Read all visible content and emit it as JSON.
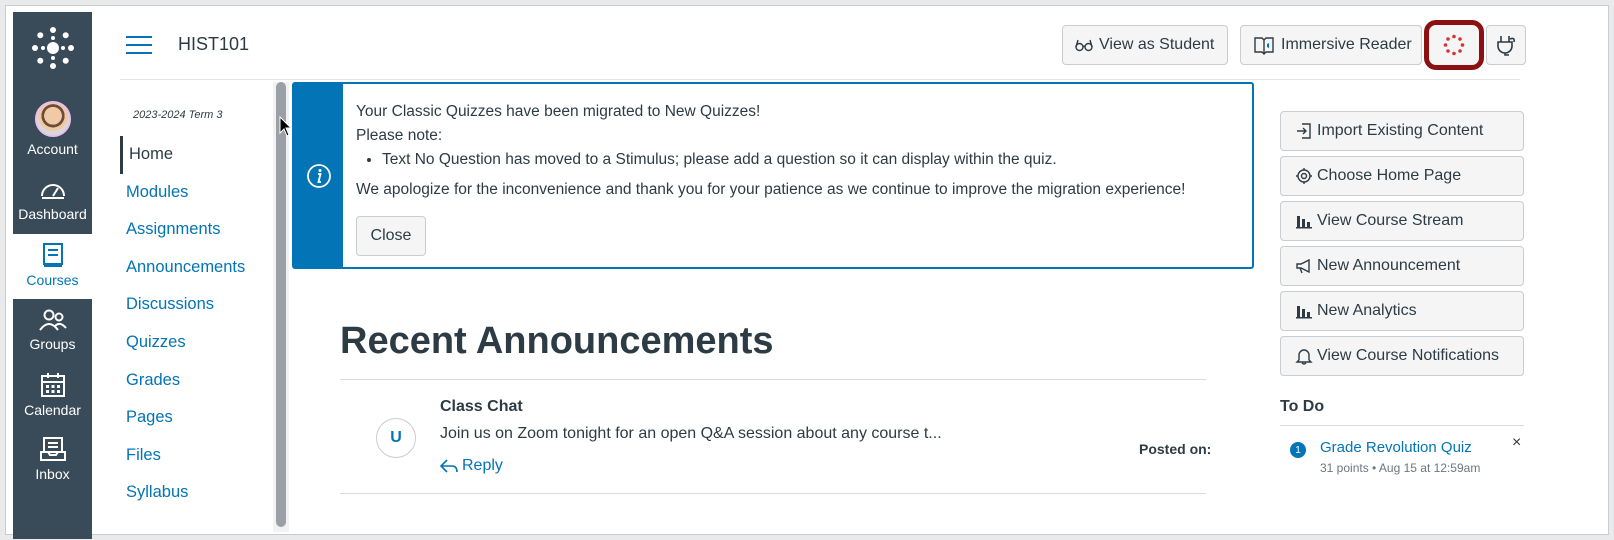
{
  "global_nav": {
    "items": [
      {
        "label": "Account",
        "icon": "account-avatar"
      },
      {
        "label": "Dashboard",
        "icon": "dashboard-icon"
      },
      {
        "label": "Courses",
        "icon": "courses-icon"
      },
      {
        "label": "Groups",
        "icon": "groups-icon"
      },
      {
        "label": "Calendar",
        "icon": "calendar-icon"
      },
      {
        "label": "Inbox",
        "icon": "inbox-icon"
      }
    ],
    "active": "Courses"
  },
  "header": {
    "course_code": "HIST101",
    "view_as_student": "View as Student",
    "immersive_reader": "Immersive Reader"
  },
  "course_nav": {
    "term": "2023-2024 Term 3",
    "items": [
      "Home",
      "Modules",
      "Assignments",
      "Announcements",
      "Discussions",
      "Quizzes",
      "Grades",
      "Pages",
      "Files",
      "Syllabus"
    ],
    "active": "Home"
  },
  "alert": {
    "line1": "Your Classic Quizzes have been migrated to New Quizzes!",
    "line2": "Please note:",
    "bullet": "Text No Question has moved to a Stimulus; please add a question so it can display within the quiz.",
    "apology": "We apologize for the inconvenience and thank you for your patience as we continue to improve the migration experience!",
    "close_label": "Close"
  },
  "recent": {
    "heading": "Recent Announcements",
    "items": [
      {
        "avatar_initial": "U",
        "title": "Class Chat",
        "excerpt": "Join us on Zoom tonight for an open Q&A session about any course t...",
        "reply_label": "Reply",
        "posted_label": "Posted on:"
      }
    ]
  },
  "sidebar": {
    "buttons": [
      "Import Existing Content",
      "Choose Home Page",
      "View Course Stream",
      "New Announcement",
      "New Analytics",
      "View Course Notifications"
    ],
    "todo": {
      "heading": "To Do",
      "items": [
        {
          "badge": "1",
          "title": "Grade Revolution Quiz",
          "meta": "31 points • Aug 15 at 12:59am",
          "dismiss": "×"
        }
      ]
    }
  },
  "colors": {
    "nav_dark": "#394b58",
    "link_blue": "#0374b5",
    "highlight_red": "#8c0f12"
  }
}
